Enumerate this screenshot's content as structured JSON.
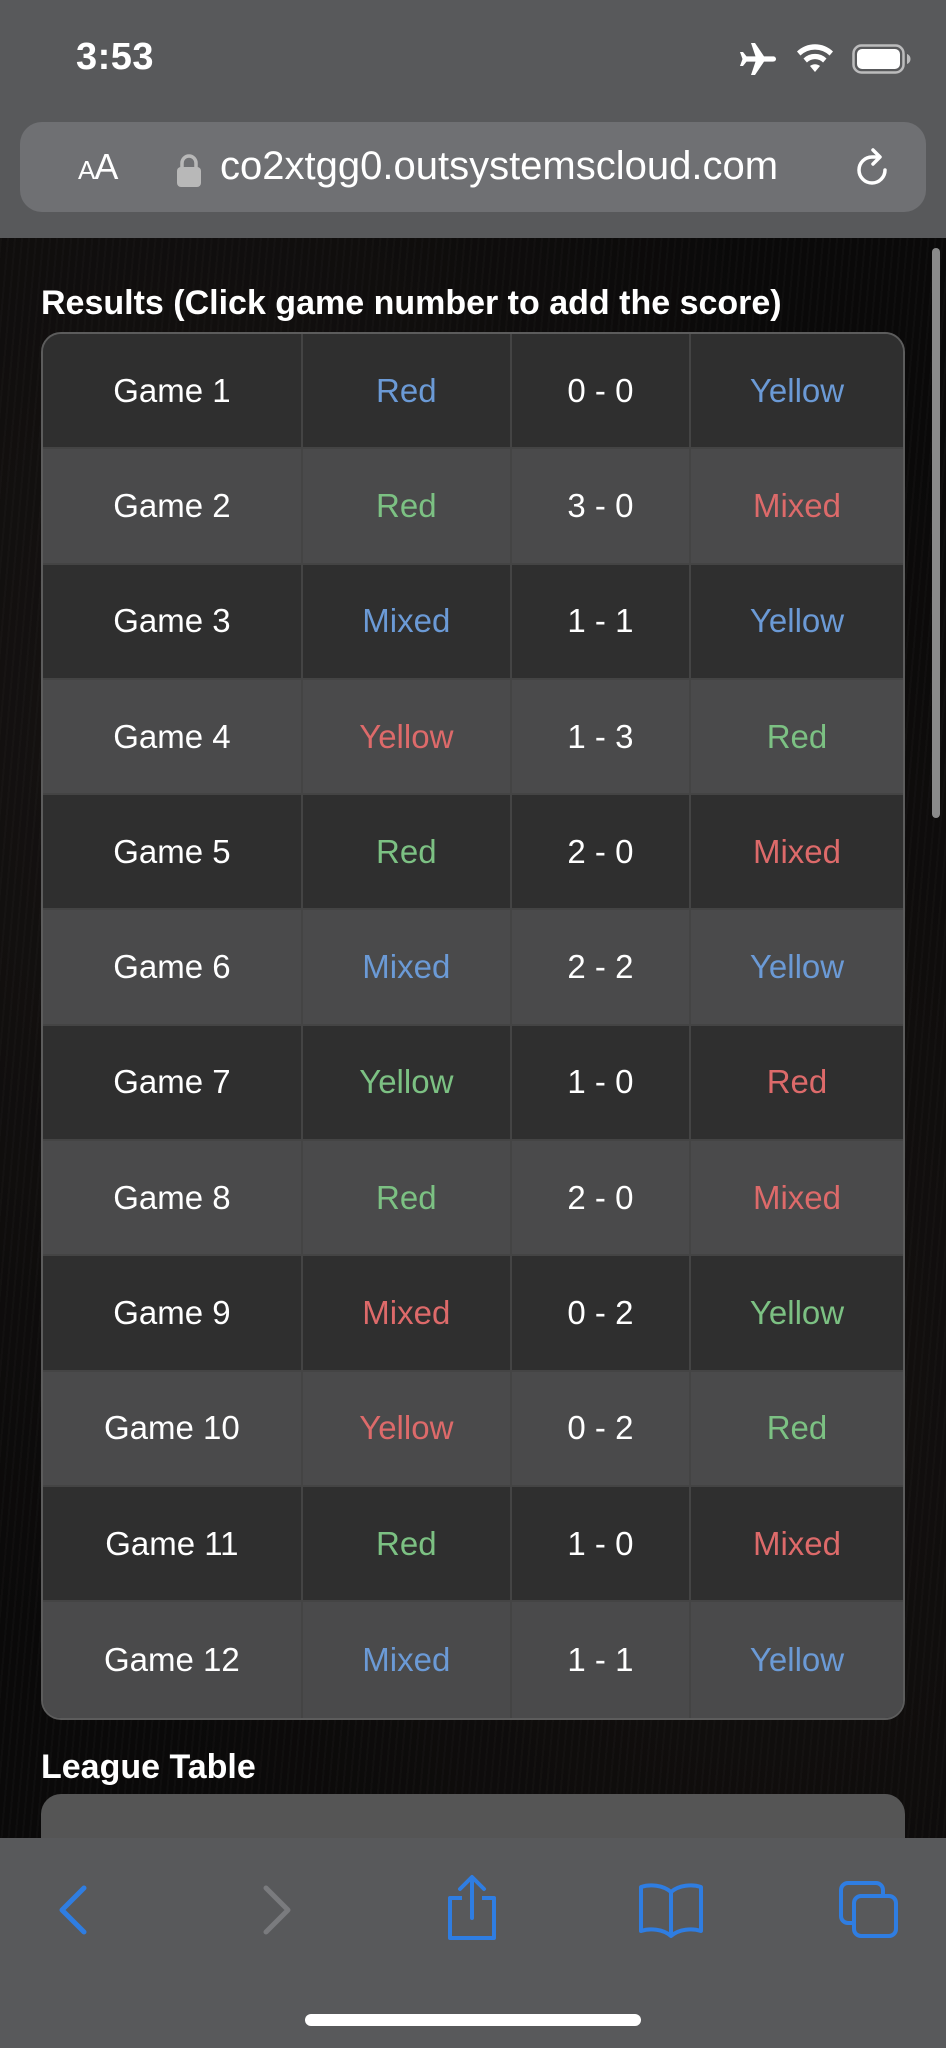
{
  "status_bar": {
    "time": "3:53",
    "icons": [
      "airplane-icon",
      "wifi-icon",
      "battery-icon"
    ]
  },
  "browser": {
    "text_size_label": "AA",
    "url": "co2xtgg0.outsystemscloud.com",
    "toolbar_icons": [
      "back-icon",
      "forward-icon",
      "share-icon",
      "bookmarks-icon",
      "tabs-icon"
    ]
  },
  "colors": {
    "blue": "#6b9ad6",
    "green": "#7cc183",
    "red": "#dd6a6a",
    "accent": "#2f7de1"
  },
  "results": {
    "title": "Results (Click game number to add the score)",
    "rows": [
      {
        "game": "Game 1",
        "team1": "Red",
        "score": "0 - 0",
        "team2": "Yellow",
        "team1_color": "blue",
        "team2_color": "blue"
      },
      {
        "game": "Game 2",
        "team1": "Red",
        "score": "3 - 0",
        "team2": "Mixed",
        "team1_color": "green",
        "team2_color": "red"
      },
      {
        "game": "Game 3",
        "team1": "Mixed",
        "score": "1 - 1",
        "team2": "Yellow",
        "team1_color": "blue",
        "team2_color": "blue"
      },
      {
        "game": "Game 4",
        "team1": "Yellow",
        "score": "1 - 3",
        "team2": "Red",
        "team1_color": "red",
        "team2_color": "green"
      },
      {
        "game": "Game 5",
        "team1": "Red",
        "score": "2 - 0",
        "team2": "Mixed",
        "team1_color": "green",
        "team2_color": "red"
      },
      {
        "game": "Game 6",
        "team1": "Mixed",
        "score": "2 - 2",
        "team2": "Yellow",
        "team1_color": "blue",
        "team2_color": "blue"
      },
      {
        "game": "Game 7",
        "team1": "Yellow",
        "score": "1 - 0",
        "team2": "Red",
        "team1_color": "green",
        "team2_color": "red"
      },
      {
        "game": "Game 8",
        "team1": "Red",
        "score": "2 - 0",
        "team2": "Mixed",
        "team1_color": "green",
        "team2_color": "red"
      },
      {
        "game": "Game 9",
        "team1": "Mixed",
        "score": "0 - 2",
        "team2": "Yellow",
        "team1_color": "red",
        "team2_color": "green"
      },
      {
        "game": "Game 10",
        "team1": "Yellow",
        "score": "0 - 2",
        "team2": "Red",
        "team1_color": "red",
        "team2_color": "green"
      },
      {
        "game": "Game 11",
        "team1": "Red",
        "score": "1 - 0",
        "team2": "Mixed",
        "team1_color": "green",
        "team2_color": "red"
      },
      {
        "game": "Game 12",
        "team1": "Mixed",
        "score": "1 - 1",
        "team2": "Yellow",
        "team1_color": "blue",
        "team2_color": "blue"
      }
    ]
  },
  "league": {
    "title": "League Table"
  }
}
